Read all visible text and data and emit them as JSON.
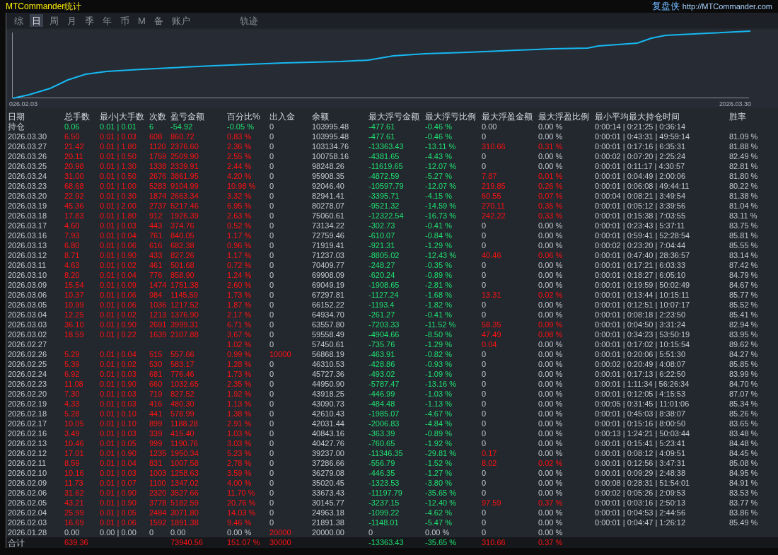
{
  "window": {
    "title": "MTCommander统计",
    "brand": "复盘侠",
    "url": "http://MTCommander.com"
  },
  "tabs": [
    {
      "label": "综",
      "selected": false
    },
    {
      "label": "日",
      "selected": true
    },
    {
      "label": "周",
      "selected": false
    },
    {
      "label": "月",
      "selected": false
    },
    {
      "label": "季",
      "selected": false
    },
    {
      "label": "年",
      "selected": false
    },
    {
      "label": "币",
      "selected": false
    },
    {
      "label": "M",
      "selected": false
    },
    {
      "label": "备",
      "selected": false
    },
    {
      "label": "账户",
      "selected": false
    },
    {
      "label": "轨迹",
      "selected": false
    }
  ],
  "chart": {
    "start_label": "026.02.03",
    "end_label": "2026.03.30"
  },
  "table": {
    "columns": [
      "日期",
      "总手数",
      "最小|大手数",
      "次数",
      "盈亏金额",
      "百分比%",
      "出入金",
      "余额",
      "最大浮亏金额",
      "最大浮亏比例",
      "最大浮盈金额",
      "最大浮盈比例",
      "最小平均最大持仓时间",
      "胜率"
    ],
    "rows": [
      {
        "kind": "holding",
        "date": "持仓",
        "lots": "0.06",
        "lot_range": "0.01 | 0.01",
        "trades": "6",
        "pnl": "-54.92",
        "pct": "-0.05 %",
        "flow": "0",
        "balance": "103995.48",
        "loss": "-477.61",
        "loss_pct": "-0.46 %",
        "gain": "0.00",
        "gain_pct": "0.00 %",
        "times": "0:00:14 | 0:21:25 | 0:36:14"
      },
      {
        "kind": "day",
        "date": "2026.03.30",
        "lots": "6.50",
        "lot_range": "0.01 | 0.03",
        "trades": "608",
        "pnl": "860.72",
        "pct": "0.83 %",
        "flow": "0",
        "balance": "103995.48",
        "loss": "-477.61",
        "loss_pct": "-0.46 %",
        "gain": "0",
        "gain_pct": "0.00 %",
        "times": "0:00:01 | 0:43:31 | 49:59:14",
        "win": "81.09 %"
      },
      {
        "kind": "day",
        "date": "2026.03.27",
        "lots": "21.42",
        "lot_range": "0.01 | 1.80",
        "trades": "1120",
        "pnl": "2376.60",
        "pct": "2.36 %",
        "flow": "0",
        "balance": "103134.76",
        "loss": "-13363.43",
        "loss_pct": "-13.11 %",
        "gain": "310.66",
        "gain_pct": "0.31 %",
        "times": "0:00:01 | 0:17:16 | 6:35:31",
        "win": "81.88 %"
      },
      {
        "kind": "day",
        "date": "2026.03.26",
        "lots": "20.11",
        "lot_range": "0.01 | 0.50",
        "trades": "1759",
        "pnl": "2509.90",
        "pct": "2.55 %",
        "flow": "0",
        "balance": "100758.16",
        "loss": "-4381.65",
        "loss_pct": "-4.43 %",
        "gain": "0",
        "gain_pct": "0.00 %",
        "times": "0:00:02 | 0:07:20 | 2:25:24",
        "win": "82.49 %"
      },
      {
        "kind": "day",
        "date": "2026.03.25",
        "lots": "20.98",
        "lot_range": "0.01 | 1.30",
        "trades": "1338",
        "pnl": "2339.91",
        "pct": "2.44 %",
        "flow": "0",
        "balance": "98248.26",
        "loss": "-11619.65",
        "loss_pct": "-12.07 %",
        "gain": "0",
        "gain_pct": "0.00 %",
        "times": "0:00:01 | 0:11:17 | 4:30:57",
        "win": "82.81 %"
      },
      {
        "kind": "day",
        "date": "2026.03.24",
        "lots": "31.00",
        "lot_range": "0.01 | 0.50",
        "trades": "2676",
        "pnl": "3861.95",
        "pct": "4.20 %",
        "flow": "0",
        "balance": "95908.35",
        "loss": "-4872.59",
        "loss_pct": "-5.27 %",
        "gain": "7.87",
        "gain_pct": "0.01 %",
        "times": "0:00:01 | 0:04:49 | 2:00:06",
        "win": "81.80 %"
      },
      {
        "kind": "day",
        "date": "2026.03.23",
        "lots": "68.68",
        "lot_range": "0.01 | 1.00",
        "trades": "5283",
        "pnl": "9104.99",
        "pct": "10.98 %",
        "flow": "0",
        "balance": "92046.40",
        "loss": "-10597.79",
        "loss_pct": "-12.07 %",
        "gain": "219.85",
        "gain_pct": "0.26 %",
        "times": "0:00:01 | 0:06:08 | 49:44:11",
        "win": "80.22 %"
      },
      {
        "kind": "day",
        "date": "2026.03.20",
        "lots": "22.92",
        "lot_range": "0.01 | 0.30",
        "trades": "1874",
        "pnl": "2663.34",
        "pct": "3.32 %",
        "flow": "0",
        "balance": "82941.41",
        "loss": "-3395.71",
        "loss_pct": "-4.15 %",
        "gain": "60.55",
        "gain_pct": "0.07 %",
        "times": "0:00:04 | 0:08:21 | 3:49:54",
        "win": "81.38 %"
      },
      {
        "kind": "day",
        "date": "2026.03.19",
        "lots": "45.36",
        "lot_range": "0.01 | 2.00",
        "trades": "2737",
        "pnl": "5217.46",
        "pct": "6.95 %",
        "flow": "0",
        "balance": "80278.07",
        "loss": "-9521.32",
        "loss_pct": "-14.59 %",
        "gain": "270.11",
        "gain_pct": "0.35 %",
        "times": "0:00:01 | 0:05:12 | 3:39:56",
        "win": "81.04 %"
      },
      {
        "kind": "day",
        "date": "2026.03.18",
        "lots": "17.83",
        "lot_range": "0.01 | 1.80",
        "trades": "912",
        "pnl": "1926.39",
        "pct": "2.63 %",
        "flow": "0",
        "balance": "75060.61",
        "loss": "-12322.54",
        "loss_pct": "-16.73 %",
        "gain": "242.22",
        "gain_pct": "0.33 %",
        "times": "0:00:01 | 0:15:38 | 7:03:55",
        "win": "83.11 %"
      },
      {
        "kind": "day",
        "date": "2026.03.17",
        "lots": "4.60",
        "lot_range": "0.01 | 0.03",
        "trades": "443",
        "pnl": "374.76",
        "pct": "0.52 %",
        "flow": "0",
        "balance": "73134.22",
        "loss": "-302.73",
        "loss_pct": "-0.41 %",
        "gain": "0",
        "gain_pct": "0.00 %",
        "times": "0:00:01 | 0:23:43 | 5:37:11",
        "win": "83.75 %"
      },
      {
        "kind": "day",
        "date": "2026.03.16",
        "lots": "7.93",
        "lot_range": "0.01 | 0.04",
        "trades": "761",
        "pnl": "840.05",
        "pct": "1.17 %",
        "flow": "0",
        "balance": "72759.46",
        "loss": "-610.07",
        "loss_pct": "-0.84 %",
        "gain": "0",
        "gain_pct": "0.00 %",
        "times": "0:00:01 | 0:59:41 | 52:28:54",
        "win": "85.81 %"
      },
      {
        "kind": "day",
        "date": "2026.03.13",
        "lots": "6.80",
        "lot_range": "0.01 | 0.06",
        "trades": "616",
        "pnl": "682.38",
        "pct": "0.96 %",
        "flow": "0",
        "balance": "71919.41",
        "loss": "-921.31",
        "loss_pct": "-1.29 %",
        "gain": "0",
        "gain_pct": "0.00 %",
        "times": "0:00:02 | 0:23:20 | 7:04:44",
        "win": "85.55 %"
      },
      {
        "kind": "day",
        "date": "2026.03.12",
        "lots": "8.71",
        "lot_range": "0.01 | 0.90",
        "trades": "433",
        "pnl": "827.26",
        "pct": "1.17 %",
        "flow": "0",
        "balance": "71237.03",
        "loss": "-8805.02",
        "loss_pct": "-12.43 %",
        "gain": "40.46",
        "gain_pct": "0.06 %",
        "times": "0:00:01 | 0:47:40 | 28:36:57",
        "win": "83.14 %"
      },
      {
        "kind": "day",
        "date": "2026.03.11",
        "lots": "4.63",
        "lot_range": "0.01 | 0.02",
        "trades": "461",
        "pnl": "501.68",
        "pct": "0.72 %",
        "flow": "0",
        "balance": "70409.77",
        "loss": "-248.27",
        "loss_pct": "-0.35 %",
        "gain": "0",
        "gain_pct": "0.00 %",
        "times": "0:00:01 | 0:17:21 | 6:03:33",
        "win": "87.42 %"
      },
      {
        "kind": "day",
        "date": "2026.03.10",
        "lots": "8.20",
        "lot_range": "0.01 | 0.04",
        "trades": "776",
        "pnl": "858.90",
        "pct": "1.24 %",
        "flow": "0",
        "balance": "69908.09",
        "loss": "-620.24",
        "loss_pct": "-0.89 %",
        "gain": "0",
        "gain_pct": "0.00 %",
        "times": "0:00:01 | 0:18:27 | 6:05:10",
        "win": "84.79 %"
      },
      {
        "kind": "day",
        "date": "2026.03.09",
        "lots": "15.54",
        "lot_range": "0.01 | 0.09",
        "trades": "1474",
        "pnl": "1751.38",
        "pct": "2.60 %",
        "flow": "0",
        "balance": "69049.19",
        "loss": "-1908.65",
        "loss_pct": "-2.81 %",
        "gain": "0",
        "gain_pct": "0.00 %",
        "times": "0:00:01 | 0:19:59 | 50:02:49",
        "win": "84.67 %"
      },
      {
        "kind": "day",
        "date": "2026.03.06",
        "lots": "10.37",
        "lot_range": "0.01 | 0.06",
        "trades": "984",
        "pnl": "1145.59",
        "pct": "1.73 %",
        "flow": "0",
        "balance": "67297.81",
        "loss": "-1127.24",
        "loss_pct": "-1.68 %",
        "gain": "13.31",
        "gain_pct": "0.02 %",
        "times": "0:00:01 | 0:13:44 | 10:15:11",
        "win": "85.77 %"
      },
      {
        "kind": "day",
        "date": "2026.03.05",
        "lots": "10.99",
        "lot_range": "0.01 | 0.06",
        "trades": "1036",
        "pnl": "1217.52",
        "pct": "1.87 %",
        "flow": "0",
        "balance": "66152.22",
        "loss": "-1193.4",
        "loss_pct": "-1.82 %",
        "gain": "0",
        "gain_pct": "0.00 %",
        "times": "0:00:01 | 0:12:51 | 10:07:17",
        "win": "85.52 %"
      },
      {
        "kind": "day",
        "date": "2026.03.04",
        "lots": "12.25",
        "lot_range": "0.01 | 0.02",
        "trades": "1213",
        "pnl": "1376.90",
        "pct": "2.17 %",
        "flow": "0",
        "balance": "64934.70",
        "loss": "-261.27",
        "loss_pct": "-0.41 %",
        "gain": "0",
        "gain_pct": "0.00 %",
        "times": "0:00:01 | 0:08:18 | 2:23:50",
        "win": "85.41 %"
      },
      {
        "kind": "day",
        "date": "2026.03.03",
        "lots": "36.10",
        "lot_range": "0.01 | 0.90",
        "trades": "2691",
        "pnl": "3999.31",
        "pct": "6.71 %",
        "flow": "0",
        "balance": "63557.80",
        "loss": "-7203.33",
        "loss_pct": "-11.52 %",
        "gain": "58.35",
        "gain_pct": "0.09 %",
        "times": "0:00:01 | 0:04:50 | 3:31:24",
        "win": "82.94 %"
      },
      {
        "kind": "day",
        "date": "2026.03.02",
        "lots": "18.59",
        "lot_range": "0.01 | 0.22",
        "trades": "1639",
        "pnl": "2107.88",
        "pct": "3.67 %",
        "flow": "0",
        "balance": "59558.49",
        "loss": "-4904.66",
        "loss_pct": "-8.50 %",
        "gain": "47.49",
        "gain_pct": "0.08 %",
        "times": "0:00:01 | 0:34:23 | 53:50:19",
        "win": "83.95 %"
      },
      {
        "kind": "day",
        "date": "2026.02.27",
        "pct": "1.02 %",
        "flow": "0",
        "balance": "57450.61",
        "loss": "-735.76",
        "loss_pct": "-1.29 %",
        "gain": "0.04",
        "gain_pct": "0.00 %",
        "times": "0:00:01 | 0:17:02 | 10:15:54",
        "win": "89.62 %"
      },
      {
        "kind": "day",
        "date": "2026.02.26",
        "lots": "5.29",
        "lot_range": "0.01 | 0.04",
        "trades": "515",
        "pnl": "557.66",
        "pct": "0.99 %",
        "flow": "10000",
        "balance": "56868.19",
        "loss": "-463.91",
        "loss_pct": "-0.82 %",
        "gain": "0",
        "gain_pct": "0.00 %",
        "times": "0:00:01 | 0:20:06 | 5:51:30",
        "win": "84.27 %"
      },
      {
        "kind": "day",
        "date": "2026.02.25",
        "lots": "5.39",
        "lot_range": "0.01 | 0.02",
        "trades": "530",
        "pnl": "583.17",
        "pct": "1.28 %",
        "flow": "0",
        "balance": "46310.53",
        "loss": "-428.86",
        "loss_pct": "-0.93 %",
        "gain": "0",
        "gain_pct": "0.00 %",
        "times": "0:00:02 | 0:20:49 | 4:08:07",
        "win": "85.85 %"
      },
      {
        "kind": "day",
        "date": "2026.02.24",
        "lots": "6.92",
        "lot_range": "0.01 | 0.03",
        "trades": "681",
        "pnl": "776.46",
        "pct": "1.73 %",
        "flow": "0",
        "balance": "45727.36",
        "loss": "-493.02",
        "loss_pct": "-1.09 %",
        "gain": "0",
        "gain_pct": "0.00 %",
        "times": "0:00:01 | 0:17:13 | 6:22:50",
        "win": "83.99 %"
      },
      {
        "kind": "day",
        "date": "2026.02.23",
        "lots": "11.08",
        "lot_range": "0.01 | 0.90",
        "trades": "660",
        "pnl": "1032.65",
        "pct": "2.35 %",
        "flow": "0",
        "balance": "44950.90",
        "loss": "-5787.47",
        "loss_pct": "-13.16 %",
        "gain": "0",
        "gain_pct": "0.00 %",
        "times": "0:00:01 | 1:11:34 | 56:26:34",
        "win": "84.70 %"
      },
      {
        "kind": "day",
        "date": "2026.02.20",
        "lots": "7.30",
        "lot_range": "0.01 | 0.03",
        "trades": "719",
        "pnl": "827.52",
        "pct": "1.92 %",
        "flow": "0",
        "balance": "43918.25",
        "loss": "-446.99",
        "loss_pct": "-1.03 %",
        "gain": "0",
        "gain_pct": "0.00 %",
        "times": "0:00:01 | 0:12:05 | 4:15:53",
        "win": "87.07 %"
      },
      {
        "kind": "day",
        "date": "2026.02.19",
        "lots": "4.33",
        "lot_range": "0.01 | 0.03",
        "trades": "416",
        "pnl": "480.30",
        "pct": "1.13 %",
        "flow": "0",
        "balance": "43090.73",
        "loss": "-484.48",
        "loss_pct": "-1.13 %",
        "gain": "0",
        "gain_pct": "0.00 %",
        "times": "0:00:05 | 0:31:45 | 11:01:06",
        "win": "85.34 %"
      },
      {
        "kind": "day",
        "date": "2026.02.18",
        "lots": "5.28",
        "lot_range": "0.01 | 0.10",
        "trades": "441",
        "pnl": "578.99",
        "pct": "1.38 %",
        "flow": "0",
        "balance": "42610.43",
        "loss": "-1985.07",
        "loss_pct": "-4.67 %",
        "gain": "0",
        "gain_pct": "0.00 %",
        "times": "0:00:01 | 0:45:03 | 8:38:07",
        "win": "85.26 %"
      },
      {
        "kind": "day",
        "date": "2026.02.17",
        "lots": "10.05",
        "lot_range": "0.01 | 0.10",
        "trades": "899",
        "pnl": "1188.28",
        "pct": "2.91 %",
        "flow": "0",
        "balance": "42031.44",
        "loss": "-2006.83",
        "loss_pct": "-4.84 %",
        "gain": "0",
        "gain_pct": "0.00 %",
        "times": "0:00:01 | 0:15:16 | 8:00:50",
        "win": "83.65 %"
      },
      {
        "kind": "day",
        "date": "2026.02.16",
        "lots": "3.49",
        "lot_range": "0.01 | 0.03",
        "trades": "339",
        "pnl": "415.40",
        "pct": "1.03 %",
        "flow": "0",
        "balance": "40843.16",
        "loss": "-363.39",
        "loss_pct": "-0.89 %",
        "gain": "0",
        "gain_pct": "0.00 %",
        "times": "0:00:13 | 1:24:21 | 50:03:44",
        "win": "83.48 %"
      },
      {
        "kind": "day",
        "date": "2026.02.13",
        "lots": "10.46",
        "lot_range": "0.01 | 0.05",
        "trades": "999",
        "pnl": "1190.76",
        "pct": "3.03 %",
        "flow": "0",
        "balance": "40427.76",
        "loss": "-760.65",
        "loss_pct": "-1.92 %",
        "gain": "0",
        "gain_pct": "0.00 %",
        "times": "0:00:01 | 0:15:41 | 5:23:41",
        "win": "84.48 %"
      },
      {
        "kind": "day",
        "date": "2026.02.12",
        "lots": "17.01",
        "lot_range": "0.01 | 0.90",
        "trades": "1235",
        "pnl": "1950.34",
        "pct": "5.23 %",
        "flow": "0",
        "balance": "39237.00",
        "loss": "-11346.35",
        "loss_pct": "-29.81 %",
        "gain": "0.17",
        "gain_pct": "0.00 %",
        "times": "0:00:01 | 0:08:12 | 4:09:51",
        "win": "84.45 %"
      },
      {
        "kind": "day",
        "date": "2026.02.11",
        "lots": "8.59",
        "lot_range": "0.01 | 0.04",
        "trades": "831",
        "pnl": "1007.58",
        "pct": "2.78 %",
        "flow": "0",
        "balance": "37286.66",
        "loss": "-556.79",
        "loss_pct": "-1.52 %",
        "gain": "8.02",
        "gain_pct": "0.02 %",
        "times": "0:00:01 | 0:12:56 | 3:47:31",
        "win": "85.08 %"
      },
      {
        "kind": "day",
        "date": "2026.02.10",
        "lots": "10.16",
        "lot_range": "0.01 | 0.03",
        "trades": "1003",
        "pnl": "1258.63",
        "pct": "3.59 %",
        "flow": "0",
        "balance": "36279.08",
        "loss": "-446.35",
        "loss_pct": "-1.27 %",
        "gain": "0",
        "gain_pct": "0.00 %",
        "times": "0:00:01 | 0:09:29 | 2:48:38",
        "win": "84.95 %"
      },
      {
        "kind": "day",
        "date": "2026.02.09",
        "lots": "11.73",
        "lot_range": "0.01 | 0.07",
        "trades": "1100",
        "pnl": "1347.02",
        "pct": "4.00 %",
        "flow": "0",
        "balance": "35020.45",
        "loss": "-1323.53",
        "loss_pct": "-3.80 %",
        "gain": "0",
        "gain_pct": "0.00 %",
        "times": "0:00:08 | 0:28:31 | 51:54:01",
        "win": "84.91 %"
      },
      {
        "kind": "day",
        "date": "2026.02.06",
        "lots": "31.62",
        "lot_range": "0.01 | 0.90",
        "trades": "2320",
        "pnl": "3527.66",
        "pct": "11.70 %",
        "flow": "0",
        "balance": "33673.43",
        "loss": "-11197.79",
        "loss_pct": "-35.65 %",
        "gain": "0",
        "gain_pct": "0.00 %",
        "times": "0:00:02 | 0:05:26 | 2:09:53",
        "win": "83.53 %"
      },
      {
        "kind": "day",
        "date": "2026.02.05",
        "lots": "43.21",
        "lot_range": "0.01 | 0.90",
        "trades": "3778",
        "pnl": "5182.59",
        "pct": "20.76 %",
        "flow": "0",
        "balance": "30145.77",
        "loss": "-3237.15",
        "loss_pct": "-12.40 %",
        "gain": "97.59",
        "gain_pct": "0.37 %",
        "times": "0:00:01 | 0:03:16 | 2:50:13",
        "win": "83.77 %"
      },
      {
        "kind": "day",
        "date": "2026.02.04",
        "lots": "25.99",
        "lot_range": "0.01 | 0.05",
        "trades": "2484",
        "pnl": "3071.80",
        "pct": "14.03 %",
        "flow": "0",
        "balance": "24963.18",
        "loss": "-1099.22",
        "loss_pct": "-4.62 %",
        "gain": "0",
        "gain_pct": "0.00 %",
        "times": "0:00:01 | 0:04:53 | 2:44:56",
        "win": "83.86 %"
      },
      {
        "kind": "day",
        "date": "2026.02.03",
        "lots": "16.69",
        "lot_range": "0.01 | 0.06",
        "trades": "1592",
        "pnl": "1891.38",
        "pct": "9.46 %",
        "flow": "0",
        "balance": "21891.38",
        "loss": "-1148.01",
        "loss_pct": "-5.47 %",
        "gain": "0",
        "gain_pct": "0.00 %",
        "times": "0:00:01 | 0:04:47 | 1:26:12",
        "win": "85.49 %"
      },
      {
        "kind": "day",
        "date": "2026.01.28",
        "lots": "0.00",
        "lot_range": "0.00 | 0.00",
        "trades": "0",
        "pnl": "0.00",
        "pct": "0.00 %",
        "flow": "20000",
        "balance": "20000.00",
        "loss": "0",
        "loss_pct": "0.00 %",
        "gain": "0",
        "gain_pct": "0.00 %"
      },
      {
        "kind": "total",
        "date": "合计",
        "lots": "639.36",
        "pnl": "73940.56",
        "pct": "151.07 %",
        "flow": "30000",
        "loss": "-13363.43",
        "loss_pct": "-35.65 %",
        "gain": "310.66",
        "gain_pct": "0.37 %"
      }
    ]
  }
}
